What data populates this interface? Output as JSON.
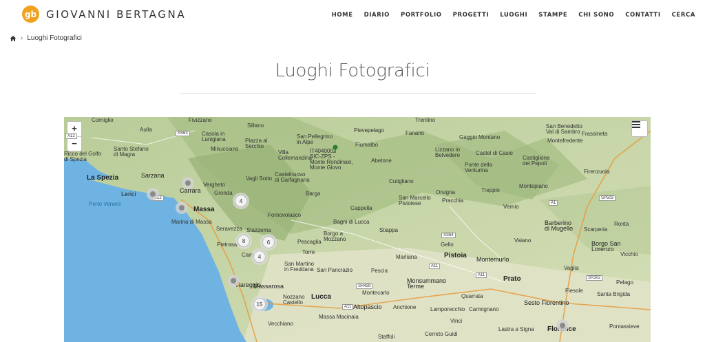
{
  "header": {
    "logo_mark": "gb",
    "site_name": "GIOVANNI BERTAGNA",
    "nav": [
      "HOME",
      "DIARIO",
      "PORTFOLIO",
      "PROGETTI",
      "LUOGHI",
      "STAMPE",
      "CHI SONO",
      "CONTATTI",
      "CERCA"
    ]
  },
  "breadcrumb": {
    "home_icon": "home-icon",
    "separator": "›",
    "current": "Luoghi Fotografici"
  },
  "page": {
    "title": "Luoghi Fotografici"
  },
  "map": {
    "zoom_in": "+",
    "zoom_out": "−",
    "layers_icon": "menu-icon",
    "colors": {
      "sea": "#6fb3e3",
      "land": "#cfdcb0",
      "mountain": "#a9c08c",
      "urban": "#e9e4d8"
    },
    "labels": [
      {
        "t": "Corniglio"
      },
      {
        "t": "Fivizzano"
      },
      {
        "t": "Sillano"
      },
      {
        "t": "Trentino"
      },
      {
        "t": "San Benedetto\nVal di Sambro"
      },
      {
        "t": "Aulla"
      },
      {
        "t": "Casola in\nLunigiana"
      },
      {
        "t": "San Pellegrino\nin Alpe"
      },
      {
        "t": "Pievepelago"
      },
      {
        "t": "Fanano"
      },
      {
        "t": "Gaggio Montano"
      },
      {
        "t": "Frassineta"
      },
      {
        "t": "Santo Stefano\ndi Magra"
      },
      {
        "t": "Minucciano"
      },
      {
        "t": "Piazza al\nSerchio"
      },
      {
        "t": "Fiumalbo"
      },
      {
        "t": "Montefredente"
      },
      {
        "t": "Ricco del Golfo\ndi Spezia"
      },
      {
        "t": "Villa\nCollemandina"
      },
      {
        "t": "IT4040002\nSIC-ZPS -\nMonte Rondinaio,\nMonte Giovo"
      },
      {
        "t": "Abetone"
      },
      {
        "t": "Lizzano in\nBelvedere"
      },
      {
        "t": "Castel di Casio"
      },
      {
        "t": "Castiglione\ndei Pepoli"
      },
      {
        "t": "La Spezia"
      },
      {
        "t": "Sarzana"
      },
      {
        "t": "Vergheto"
      },
      {
        "t": "Vagli Sotto"
      },
      {
        "t": "Castelnuovo\ndi Garfagnana"
      },
      {
        "t": "Ponte della\nVenturina"
      },
      {
        "t": "Firenzuola"
      },
      {
        "t": "Lerici"
      },
      {
        "t": "Carrara"
      },
      {
        "t": "Gronda"
      },
      {
        "t": "Cutigliano"
      },
      {
        "t": "Orsigna"
      },
      {
        "t": "Treppio"
      },
      {
        "t": "Montepiano"
      },
      {
        "t": "Porto Venere"
      },
      {
        "t": "Massa"
      },
      {
        "t": "Barga"
      },
      {
        "t": "Cappella"
      },
      {
        "t": "San Marcello\nPistoiese"
      },
      {
        "t": "Pracchia"
      },
      {
        "t": "Vernio"
      },
      {
        "t": "Marina di Massa"
      },
      {
        "t": "Fornovolasco"
      },
      {
        "t": "Bagni di Lucca"
      },
      {
        "t": "Barberino\ndi Mugello"
      },
      {
        "t": "Scarperia"
      },
      {
        "t": "Ronta"
      },
      {
        "t": "Seravezza"
      },
      {
        "t": "Stazzema"
      },
      {
        "t": "Stiappa"
      },
      {
        "t": "Borgo a\nMozzano"
      },
      {
        "t": "Gello"
      },
      {
        "t": "Vaiano"
      },
      {
        "t": "Borgo San\nLorenzo"
      },
      {
        "t": "Pietrasanta"
      },
      {
        "t": "Pescaglia"
      },
      {
        "t": "Torre"
      },
      {
        "t": "Marliana"
      },
      {
        "t": "Pistoia"
      },
      {
        "t": "Montemurlo"
      },
      {
        "t": "Vicchio"
      },
      {
        "t": "Camaiore"
      },
      {
        "t": "San Martino\nin Freddana"
      },
      {
        "t": "San Pancrazio"
      },
      {
        "t": "Pescia"
      },
      {
        "t": "Vaglia"
      },
      {
        "t": "Monsummano\nTerme"
      },
      {
        "t": "Prato"
      },
      {
        "t": "Viareggio"
      },
      {
        "t": "Massarosa"
      },
      {
        "t": "Montecarlo"
      },
      {
        "t": "Quarrata"
      },
      {
        "t": "Fiesole"
      },
      {
        "t": "Pelago"
      },
      {
        "t": "Santa Brigida"
      },
      {
        "t": "Nozzano\nCastello"
      },
      {
        "t": "Lucca"
      },
      {
        "t": "Altopascio"
      },
      {
        "t": "Anchione"
      },
      {
        "t": "Lamporecchio"
      },
      {
        "t": "Carmignano"
      },
      {
        "t": "Sesto Fiorentino"
      },
      {
        "t": "Vecchiano"
      },
      {
        "t": "Massa Macinaia"
      },
      {
        "t": "Vinci"
      },
      {
        "t": "Lastra a Signa"
      },
      {
        "t": "Florence"
      },
      {
        "t": "Pontassieve"
      },
      {
        "t": "Staffoli"
      },
      {
        "t": "Cerreto Guidi"
      }
    ],
    "roads": [
      "A12",
      "A12",
      "SS63",
      "A1",
      "SP503",
      "SS64",
      "A11",
      "A11",
      "SR439",
      "A11",
      "SR302"
    ],
    "clusters": [
      {
        "count": "4"
      },
      {
        "count": "8"
      },
      {
        "count": "6"
      },
      {
        "count": "4"
      },
      {
        "count": "15"
      }
    ]
  }
}
